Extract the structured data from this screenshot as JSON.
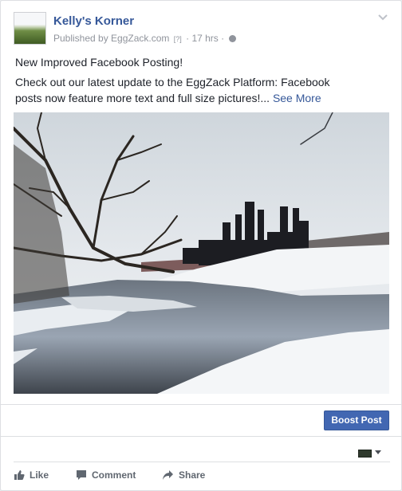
{
  "post": {
    "page_name": "Kelly's Korner",
    "published_by": "Published by EggZack.com",
    "help_marker": "[?]",
    "separator": "·",
    "time": "17 hrs",
    "separator2": "·",
    "privacy_icon": "globe-icon",
    "menu_icon": "chevron-down-icon",
    "headline": "New Improved Facebook Posting!",
    "body": "Check out our latest update to the EggZack Platform: Facebook posts now feature more text and full size pictures!...",
    "see_more": "See More",
    "photo_description_icon": "landscape-photo"
  },
  "boost_label": "Boost Post",
  "actions": {
    "like": "Like",
    "comment": "Comment",
    "share": "Share"
  },
  "colors": {
    "link": "#365899",
    "boost": "#4267b2",
    "meta": "#90949c",
    "action": "#606770"
  }
}
